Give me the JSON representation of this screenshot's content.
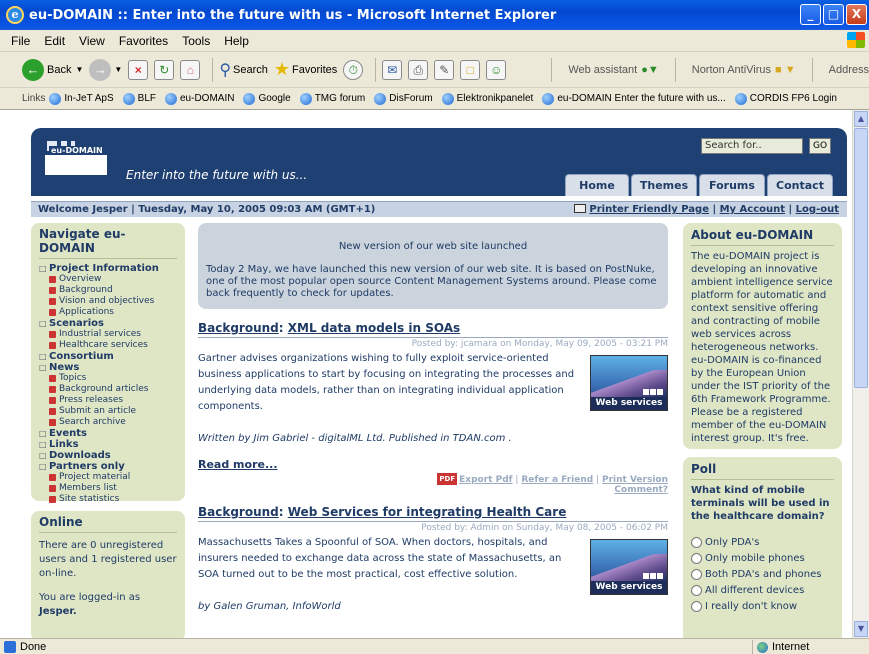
{
  "window": {
    "title": "eu-DOMAIN :: Enter into the future with us - Microsoft Internet Explorer",
    "min": "_",
    "max": "□",
    "close": "X"
  },
  "menu": [
    "File",
    "Edit",
    "View",
    "Favorites",
    "Tools",
    "Help"
  ],
  "toolbar": {
    "back": "Back",
    "search": "Search",
    "favorites": "Favorites",
    "web_assistant": "Web assistant",
    "norton": "Norton AntiVirus",
    "address": "Address"
  },
  "links": {
    "label": "Links",
    "items": [
      "In-JeT ApS",
      "BLF",
      "eu-DOMAIN",
      "Google",
      "TMG forum",
      "DisForum",
      "Elektronikpanelet",
      "eu-DOMAIN  Enter the future with us...",
      "CORDIS FP6 Login"
    ]
  },
  "header": {
    "logo_text": "eu-DOMAIN",
    "tagline": "Enter into the future with us...",
    "search_placeholder": "Search for..",
    "go": "GO",
    "tabs": [
      "Home",
      "Themes",
      "Forums",
      "Contact"
    ]
  },
  "welcome": {
    "text": "Welcome Jesper | Tuesday, May 10, 2005 09:03 AM (GMT+1)",
    "printer": "Printer Friendly Page",
    "account": "My Account",
    "logout": "Log-out"
  },
  "nav": {
    "title": "Navigate eu-DOMAIN",
    "sections": [
      {
        "label": "Project Information",
        "items": [
          "Overview",
          "Background",
          "Vision and objectives",
          "Applications"
        ]
      },
      {
        "label": "Scenarios",
        "items": [
          "Industrial services",
          "Healthcare services"
        ]
      },
      {
        "label": "Consortium",
        "items": []
      },
      {
        "label": "News",
        "items": [
          "Topics",
          "Background articles",
          "Press releases",
          "Submit an article",
          "Search archive"
        ]
      },
      {
        "label": "Events",
        "items": []
      },
      {
        "label": "Links",
        "items": []
      },
      {
        "label": "Downloads",
        "items": []
      },
      {
        "label": "Partners only",
        "items": [
          "Project material",
          "Members list",
          "Site statistics"
        ]
      }
    ]
  },
  "online": {
    "title": "Online",
    "text1": "There are 0 unregistered users and 1 registered user on-line.",
    "text2a": "You are logged-in as",
    "text2b": "Jesper."
  },
  "notice": {
    "title": "New version of our web site launched",
    "text": "Today 2 May, we have launched this new version of our web site. It is based on PostNuke, one of the most popular open source Content Management Systems around. Please come back frequently to check for updates."
  },
  "articles": [
    {
      "category": "Background",
      "title": "XML data models in SOAs",
      "posted": "Posted by: jcamara on Monday, May 09, 2005 - 03:21 PM",
      "body": "Gartner advises organizations wishing to fully exploit service-oriented business applications to start by focusing on integrating the processes and underlying data models, rather than on integrating individual application components.",
      "byline": "Written by Jim Gabriel - digitalML Ltd. Published in TDAN.com .",
      "image_caption": "Web services",
      "readmore": "Read more...",
      "pdf_badge": "PDF",
      "export_pdf": "Export Pdf",
      "refer": "Refer a Friend",
      "print": "Print Version",
      "comment": "Comment?"
    },
    {
      "category": "Background",
      "title": "Web Services for integrating Health Care",
      "posted": "Posted by: Admin on Sunday, May 08, 2005 - 06:02 PM",
      "body": "Massachusetts Takes a Spoonful of SOA. When doctors, hospitals, and insurers needed to exchange data across the state of Massachusetts, an SOA turned out to be the most practical, cost effective solution.",
      "byline": "by Galen Gruman, InfoWorld",
      "image_caption": "Web services"
    }
  ],
  "about": {
    "title": "About eu-DOMAIN",
    "text": "The eu-DOMAIN project is developing an innovative ambient intelligence service platform for automatic and context sensitive offering and contracting of mobile web services across heterogeneous networks. eu-DOMAIN is co-financed by the European Union under the IST priority of the 6th Framework Programme. Please be a registered member of the eu-DOMAIN interest group. It's free."
  },
  "poll": {
    "title": "Poll",
    "question": "What kind of mobile terminals will be used in the healthcare domain?",
    "options": [
      "Only PDA's",
      "Only mobile phones",
      "Both PDA's and phones",
      "All different devices",
      "I really don't know"
    ]
  },
  "status": {
    "text": "Done",
    "zone": "Internet"
  }
}
